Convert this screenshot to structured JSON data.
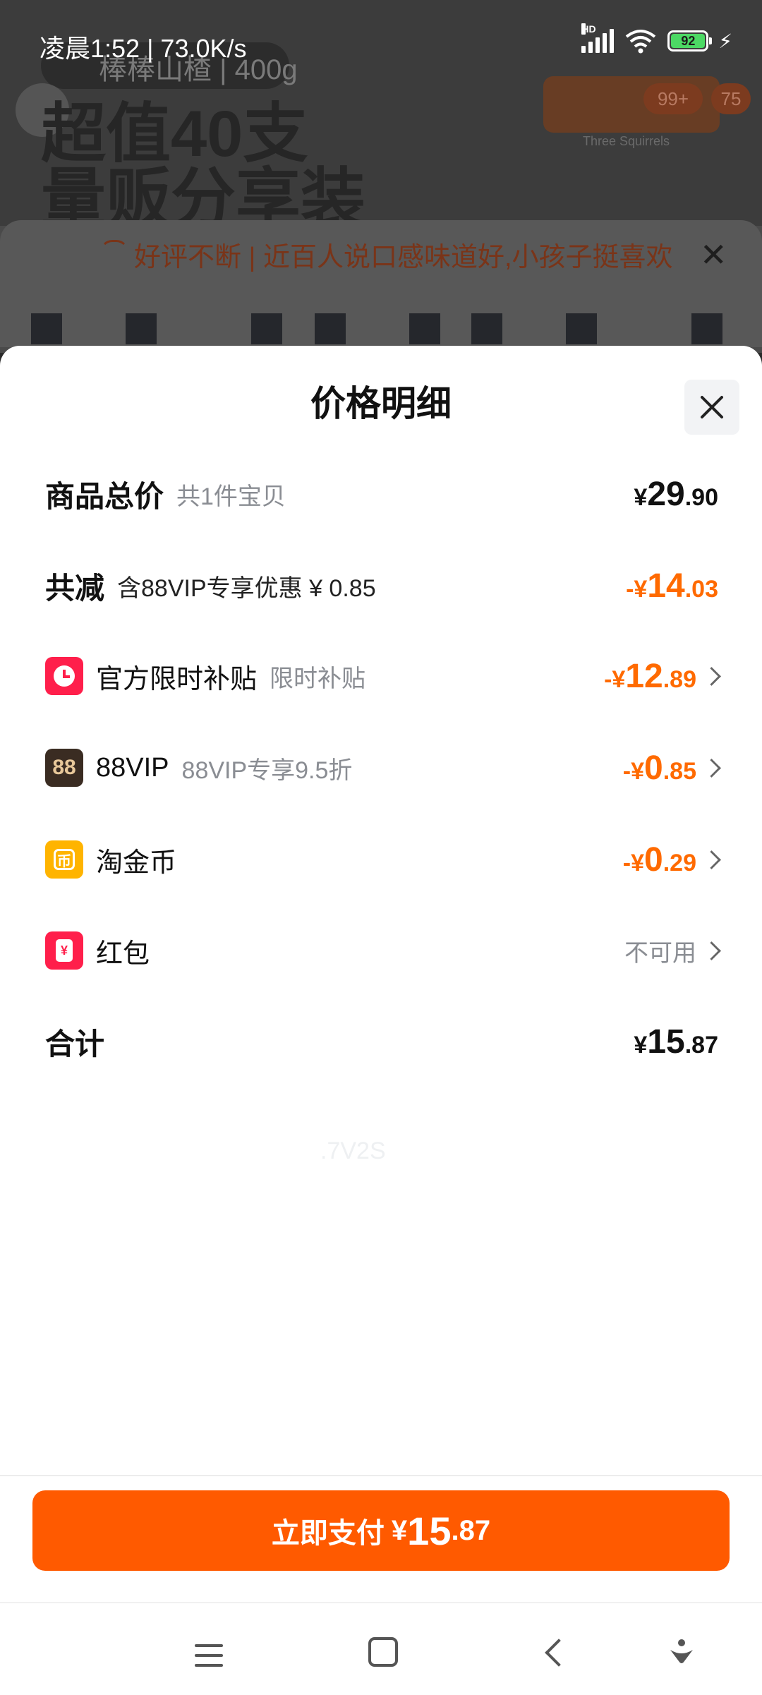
{
  "status_bar": {
    "time_speed": "凌晨1:52 | 73.0K/s",
    "network_type": "HD",
    "battery_level": "92"
  },
  "background": {
    "product_tag": "棒棒山楂 | 400g",
    "headline_line1": "超值40支",
    "headline_line2": "量贩分享装",
    "brand_sub": "Three Squirrels",
    "badge_cart": "99+",
    "badge_msg": "75",
    "tip": "好评不断 | 近百人说口感味道好,小孩子挺喜欢"
  },
  "sheet": {
    "title": "价格明细",
    "rows": {
      "total": {
        "label": "商品总价",
        "sub": "共1件宝贝",
        "cur": "¥",
        "int": "29",
        "dec": ".90"
      },
      "discount": {
        "label": "共减",
        "sub": "含88VIP专享优惠 ¥ 0.85",
        "cur": "-¥",
        "int": "14",
        "dec": ".03"
      },
      "subsidy": {
        "label": "官方限时补贴",
        "sub": "限时补贴",
        "cur": "-¥",
        "int": "12",
        "dec": ".89"
      },
      "vip": {
        "icon_text": "88",
        "label": "88VIP",
        "sub": "88VIP专享9.5折",
        "cur": "-¥",
        "int": "0",
        "dec": ".85"
      },
      "coin": {
        "icon_text": "币",
        "label": "淘金币",
        "cur": "-¥",
        "int": "0",
        "dec": ".29"
      },
      "redpacket": {
        "icon_text": "¥",
        "label": "红包",
        "status": "不可用"
      },
      "sum": {
        "label": "合计",
        "cur": "¥",
        "int": "15",
        "dec": ".87"
      }
    },
    "watermark": ".7V2S"
  },
  "pay_button": {
    "label": "立即支付",
    "cur": "¥",
    "int": "15",
    "dec": ".87"
  },
  "colors": {
    "accent": "#ff5a00",
    "discount": "#ff6a00",
    "subsidy_icon": "#ff1f4b",
    "vip_icon": "#3a2c22",
    "coin_icon": "#ffb400"
  }
}
